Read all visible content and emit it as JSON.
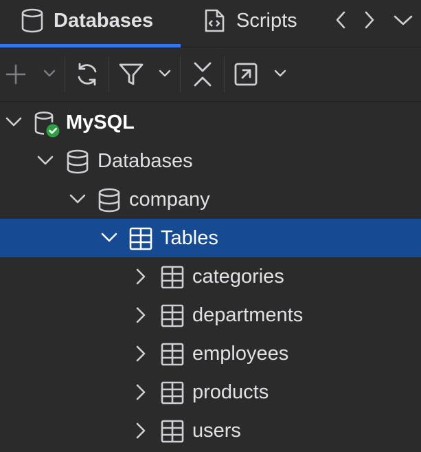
{
  "tabs": {
    "databases_label": "Databases",
    "scripts_label": "Scripts"
  },
  "toolbar": {
    "icons": [
      "plus-icon",
      "refresh-icon",
      "filter-icon",
      "collapse-all-icon",
      "open-in-new-icon"
    ]
  },
  "tree": {
    "connection_label": "MySQL",
    "connection_status": "connected",
    "databases_group_label": "Databases",
    "schema_label": "company",
    "tables_group_label": "Tables",
    "tables": [
      "categories",
      "departments",
      "employees",
      "products",
      "users"
    ]
  },
  "colors": {
    "background": "#2b2b2b",
    "selection": "#164b94",
    "tab_underline": "#3574f0",
    "connected_badge": "#2ea043"
  }
}
